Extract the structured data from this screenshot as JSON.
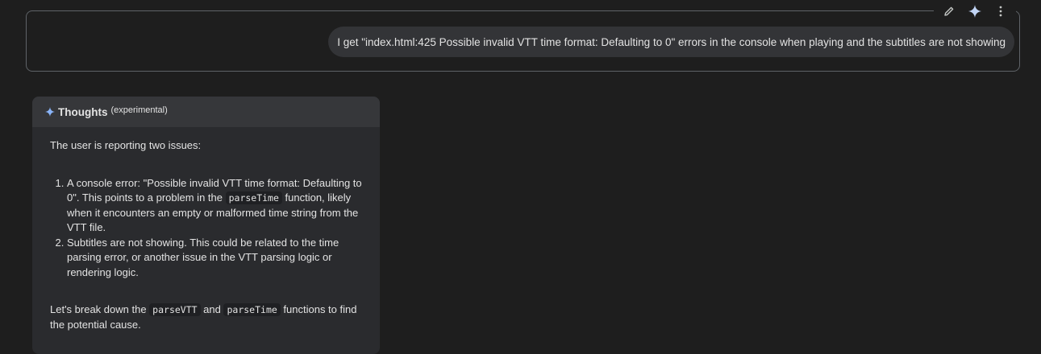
{
  "user_turn": {
    "message": "I get \"index.html:425 Possible invalid VTT time format:  Defaulting to 0\" errors in the console when playing and the subtitles are not showing",
    "actions": {
      "edit_icon": "pencil-icon",
      "sparkle_icon": "sparkle-icon",
      "more_icon": "more-vert-icon"
    }
  },
  "thoughts": {
    "title": "Thoughts",
    "subtitle": "(experimental)",
    "accent_color": "#8ab4f8",
    "intro": "The user is reporting two issues:",
    "items": [
      {
        "part1": "A console error: \"Possible invalid VTT time format: Defaulting to 0\". This points to a problem in the ",
        "code": "parseTime",
        "part2": " function, likely when it encounters an empty or malformed time string from the VTT file."
      },
      {
        "text": "Subtitles are not showing. This could be related to the time parsing error, or another issue in the VTT parsing logic or rendering logic."
      }
    ],
    "conclusion": {
      "part1": "Let's break down the ",
      "code1": "parseVTT",
      "part2": " and ",
      "code2": "parseTime",
      "part3": " functions to find the potential cause."
    }
  }
}
